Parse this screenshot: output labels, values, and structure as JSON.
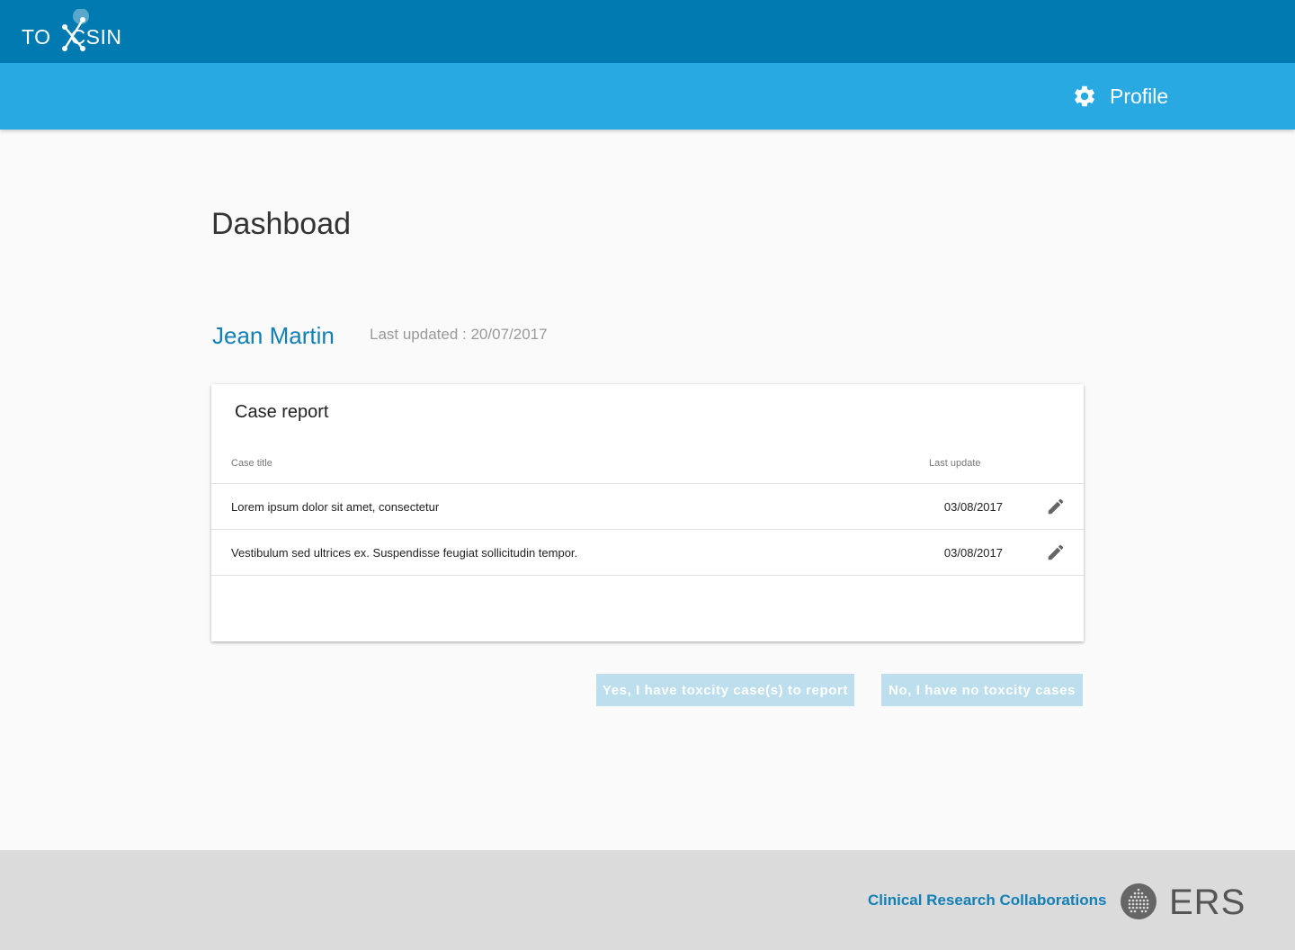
{
  "app": {
    "logo_text_left": "TO",
    "logo_text_right": "CSIN",
    "accent_dark": "#007ab1",
    "accent_light": "#29a9e1"
  },
  "nav": {
    "profile_label": "Profile",
    "profile_icon": "gear-icon"
  },
  "main": {
    "title": "Dashboad",
    "user_name": "Jean Martin",
    "last_updated": "Last updated : 20/07/2017"
  },
  "case_report": {
    "title": "Case report",
    "columns": [
      "Case title",
      "Last update"
    ],
    "rows": [
      {
        "title": "Lorem ipsum dolor sit amet, consectetur",
        "date": "03/08/2017"
      },
      {
        "title": "Vestibulum sed ultrices ex. Suspendisse feugiat sollicitudin tempor.",
        "date": "03/08/2017"
      }
    ]
  },
  "actions": {
    "yes_label": "Yes, I have toxcity case(s) to report",
    "no_label": "No, I have no toxcity cases"
  },
  "footer": {
    "link_label": "Clinical Research Collaborations",
    "ers_text": "ERS"
  }
}
